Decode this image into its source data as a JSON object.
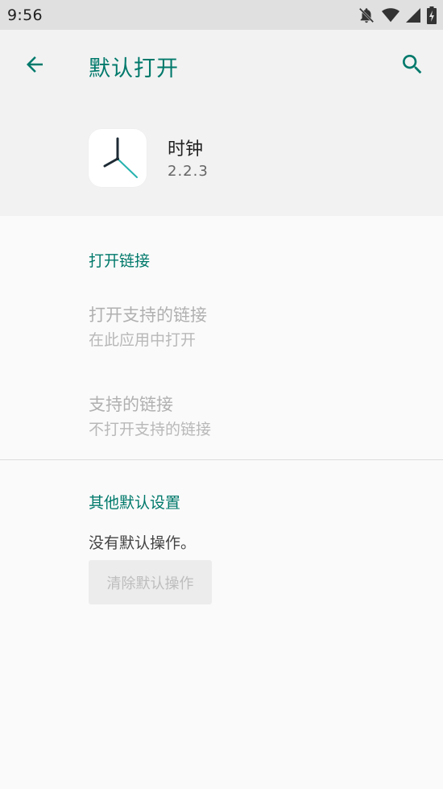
{
  "status_bar": {
    "time": "9:56"
  },
  "header": {
    "title": "默认打开"
  },
  "app": {
    "name": "时钟",
    "version": "2.2.3"
  },
  "open_links_section": {
    "title": "打开链接",
    "items": [
      {
        "title": "打开支持的链接",
        "subtitle": "在此应用中打开"
      },
      {
        "title": "支持的链接",
        "subtitle": "不打开支持的链接"
      }
    ]
  },
  "other_defaults_section": {
    "title": "其他默认设置",
    "status": "没有默认操作。",
    "clear_button_label": "清除默认操作"
  },
  "colors": {
    "accent": "#00796b",
    "background": "#fafafa",
    "status_bar": "#e0e0e0"
  },
  "icons": [
    "notifications-off-icon",
    "wifi-icon",
    "cell-signal-icon",
    "battery-charging-icon",
    "back-arrow-icon",
    "search-icon",
    "clock-app-icon"
  ]
}
